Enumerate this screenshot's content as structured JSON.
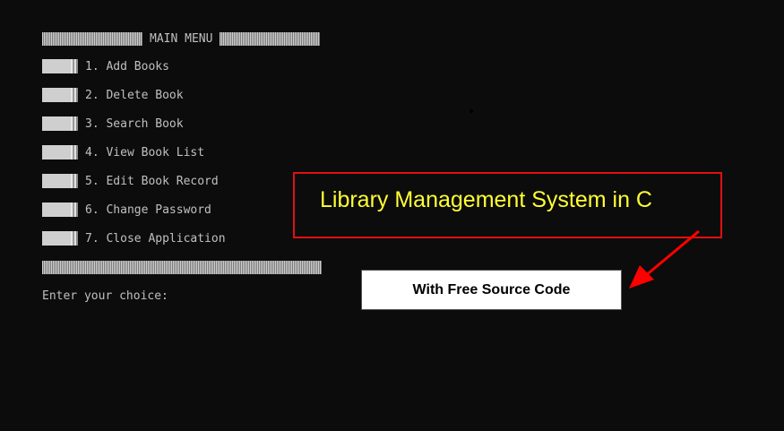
{
  "window": {
    "background_color": "#0c0c0c",
    "text_color": "#c0c0c0"
  },
  "menu": {
    "title": "MAIN MENU",
    "items": [
      {
        "label": "1. Add Books"
      },
      {
        "label": "2. Delete Book"
      },
      {
        "label": "3. Search Book"
      },
      {
        "label": "4. View Book List"
      },
      {
        "label": "5. Edit Book Record"
      },
      {
        "label": "6. Change Password"
      },
      {
        "label": "7. Close Application"
      }
    ],
    "prompt": "Enter your choice:"
  },
  "overlay": {
    "headline": "Library Management System in C",
    "headline_color": "#ffff33",
    "border_color": "#e01010",
    "badge": "With Free Source Code",
    "arrow_color": "#ff0000"
  }
}
